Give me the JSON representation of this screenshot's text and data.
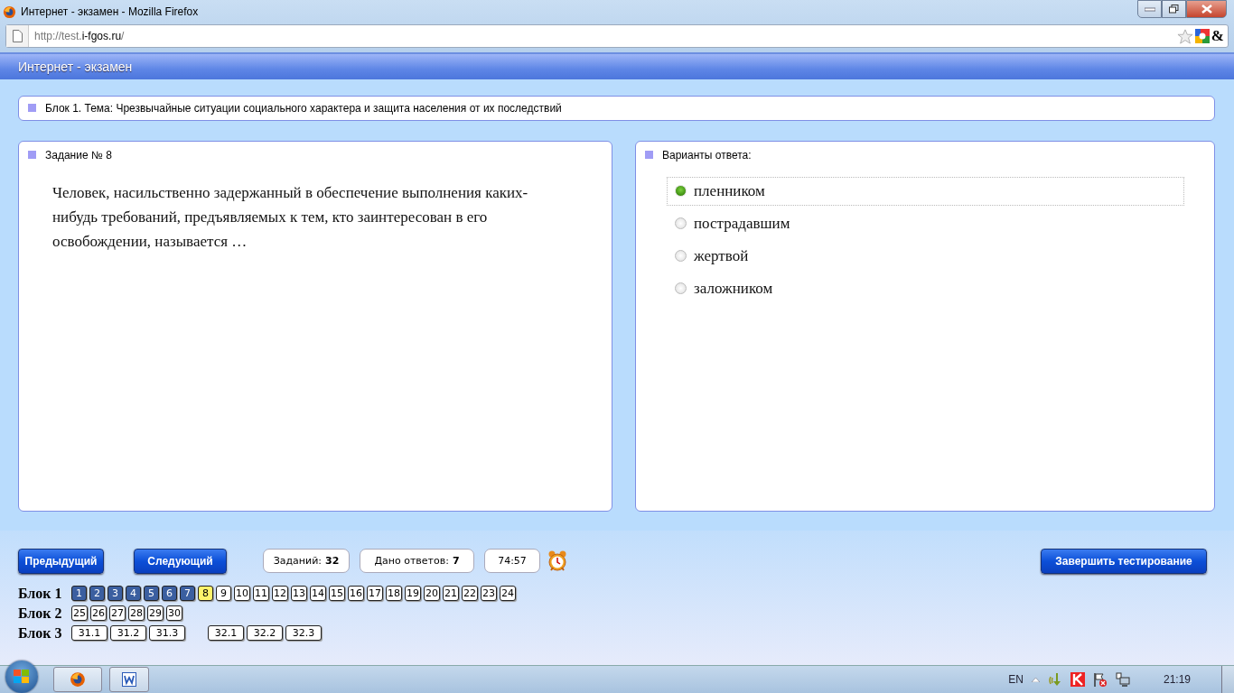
{
  "window": {
    "title": "Интернет - экзамен - Mozilla Firefox"
  },
  "address_bar": {
    "url_prefix": "http://test.",
    "url_domain": "i-fgos.ru",
    "url_suffix": "/",
    "addon_icon": "&"
  },
  "page_header": {
    "title": "Интернет - экзамен"
  },
  "block_topic": "Блок 1. Тема: Чрезвычайные ситуации социального характера и защита населения от их последствий",
  "task": {
    "heading": "Задание № 8",
    "text": "Человек, насильственно задержанный в обеспечение выполнения каких-нибудь требований, предъявляемых к тем, кто заинтересован в его освобождении, называется …"
  },
  "answers": {
    "heading": "Варианты ответа:",
    "options": [
      {
        "label": "пленником",
        "selected": true
      },
      {
        "label": "пострадавшим",
        "selected": false
      },
      {
        "label": "жертвой",
        "selected": false
      },
      {
        "label": "заложником",
        "selected": false
      }
    ]
  },
  "controls": {
    "prev_button": "Предыдущий",
    "next_button": "Следующий",
    "tasks_label": "Заданий:",
    "tasks_count": "32",
    "answered_label": "Дано ответов:",
    "answered_count": "7",
    "timer": "74:57",
    "finish_button": "Завершить тестирование"
  },
  "blocks": [
    {
      "label": "Блок 1",
      "groups": [
        [
          {
            "label": "1",
            "answered": true,
            "selected": false
          },
          {
            "label": "2",
            "answered": true,
            "selected": false
          },
          {
            "label": "3",
            "answered": true,
            "selected": false
          },
          {
            "label": "4",
            "answered": true,
            "selected": false
          },
          {
            "label": "5",
            "answered": true,
            "selected": false
          },
          {
            "label": "6",
            "answered": true,
            "selected": false
          },
          {
            "label": "7",
            "answered": true,
            "selected": false
          },
          {
            "label": "8",
            "answered": false,
            "selected": true
          },
          {
            "label": "9",
            "answered": false,
            "selected": false
          },
          {
            "label": "10",
            "answered": false,
            "selected": false
          },
          {
            "label": "11",
            "answered": false,
            "selected": false
          },
          {
            "label": "12",
            "answered": false,
            "selected": false
          },
          {
            "label": "13",
            "answered": false,
            "selected": false
          },
          {
            "label": "14",
            "answered": false,
            "selected": false
          },
          {
            "label": "15",
            "answered": false,
            "selected": false
          },
          {
            "label": "16",
            "answered": false,
            "selected": false
          },
          {
            "label": "17",
            "answered": false,
            "selected": false
          },
          {
            "label": "18",
            "answered": false,
            "selected": false
          },
          {
            "label": "19",
            "answered": false,
            "selected": false
          },
          {
            "label": "20",
            "answered": false,
            "selected": false
          },
          {
            "label": "21",
            "answered": false,
            "selected": false
          },
          {
            "label": "22",
            "answered": false,
            "selected": false
          },
          {
            "label": "23",
            "answered": false,
            "selected": false
          },
          {
            "label": "24",
            "answered": false,
            "selected": false
          }
        ]
      ]
    },
    {
      "label": "Блок 2",
      "groups": [
        [
          {
            "label": "25",
            "answered": false,
            "selected": false
          },
          {
            "label": "26",
            "answered": false,
            "selected": false
          },
          {
            "label": "27",
            "answered": false,
            "selected": false
          },
          {
            "label": "28",
            "answered": false,
            "selected": false
          },
          {
            "label": "29",
            "answered": false,
            "selected": false
          },
          {
            "label": "30",
            "answered": false,
            "selected": false
          }
        ]
      ]
    },
    {
      "label": "Блок 3",
      "groups": [
        [
          {
            "label": "31.1",
            "answered": false,
            "selected": false
          },
          {
            "label": "31.2",
            "answered": false,
            "selected": false
          },
          {
            "label": "31.3",
            "answered": false,
            "selected": false
          }
        ],
        [
          {
            "label": "32.1",
            "answered": false,
            "selected": false
          },
          {
            "label": "32.2",
            "answered": false,
            "selected": false
          },
          {
            "label": "32.3",
            "answered": false,
            "selected": false
          }
        ]
      ]
    }
  ],
  "taskbar": {
    "language": "EN",
    "clock": "21:19"
  }
}
